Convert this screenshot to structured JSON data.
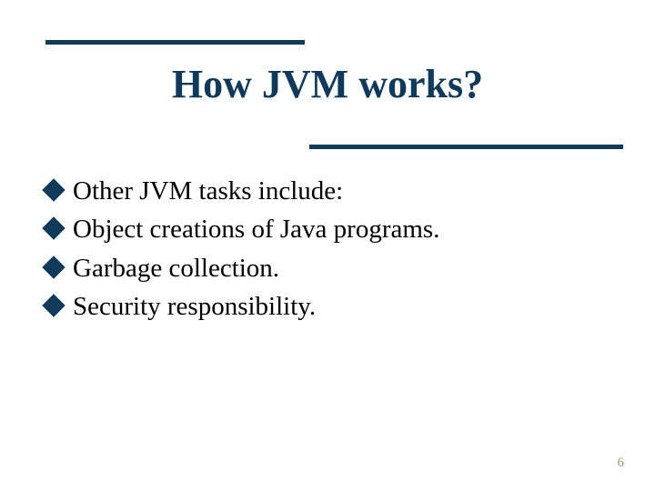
{
  "title": "How JVM works?",
  "bullets": {
    "b0": "Other JVM tasks include:",
    "b1": "Object creations of Java programs.",
    "b2": "Garbage collection.",
    "b3": "Security responsibility."
  },
  "page_number": "6",
  "colors": {
    "accent": "#0f3a5a",
    "pagenum": "#9e9e60"
  }
}
